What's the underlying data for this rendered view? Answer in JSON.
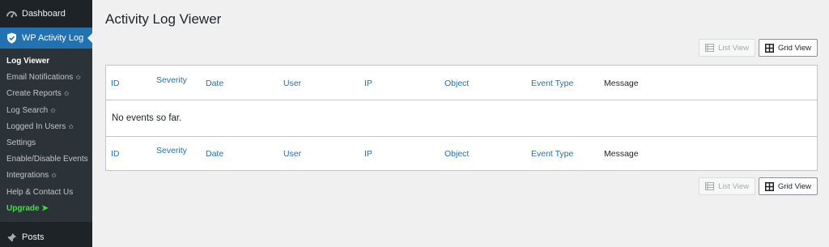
{
  "sidebar": {
    "dashboard_label": "Dashboard",
    "plugin_label": "WP Activity Log",
    "items": [
      {
        "label": "Log Viewer",
        "current": true,
        "star": false
      },
      {
        "label": "Email Notifications",
        "star": true
      },
      {
        "label": "Create Reports",
        "star": true
      },
      {
        "label": "Log Search",
        "star": true
      },
      {
        "label": "Logged In Users",
        "star": true
      },
      {
        "label": "Settings",
        "star": false
      },
      {
        "label": "Enable/Disable Events",
        "star": false
      },
      {
        "label": "Integrations",
        "star": true
      },
      {
        "label": "Help & Contact Us",
        "star": false
      },
      {
        "label": "Upgrade ➤",
        "upgrade": true
      }
    ],
    "posts_label": "Posts"
  },
  "main": {
    "title": "Activity Log Viewer",
    "view_switch": {
      "list_label": "List View",
      "grid_label": "Grid View"
    },
    "table": {
      "columns": [
        "ID",
        "Severity",
        "Date",
        "User",
        "IP",
        "Object",
        "Event Type",
        "Message"
      ],
      "empty_message": "No events so far."
    }
  },
  "colors": {
    "sidebar_bg": "#1d2327",
    "accent": "#2271b1",
    "upgrade": "#3fe03f"
  }
}
